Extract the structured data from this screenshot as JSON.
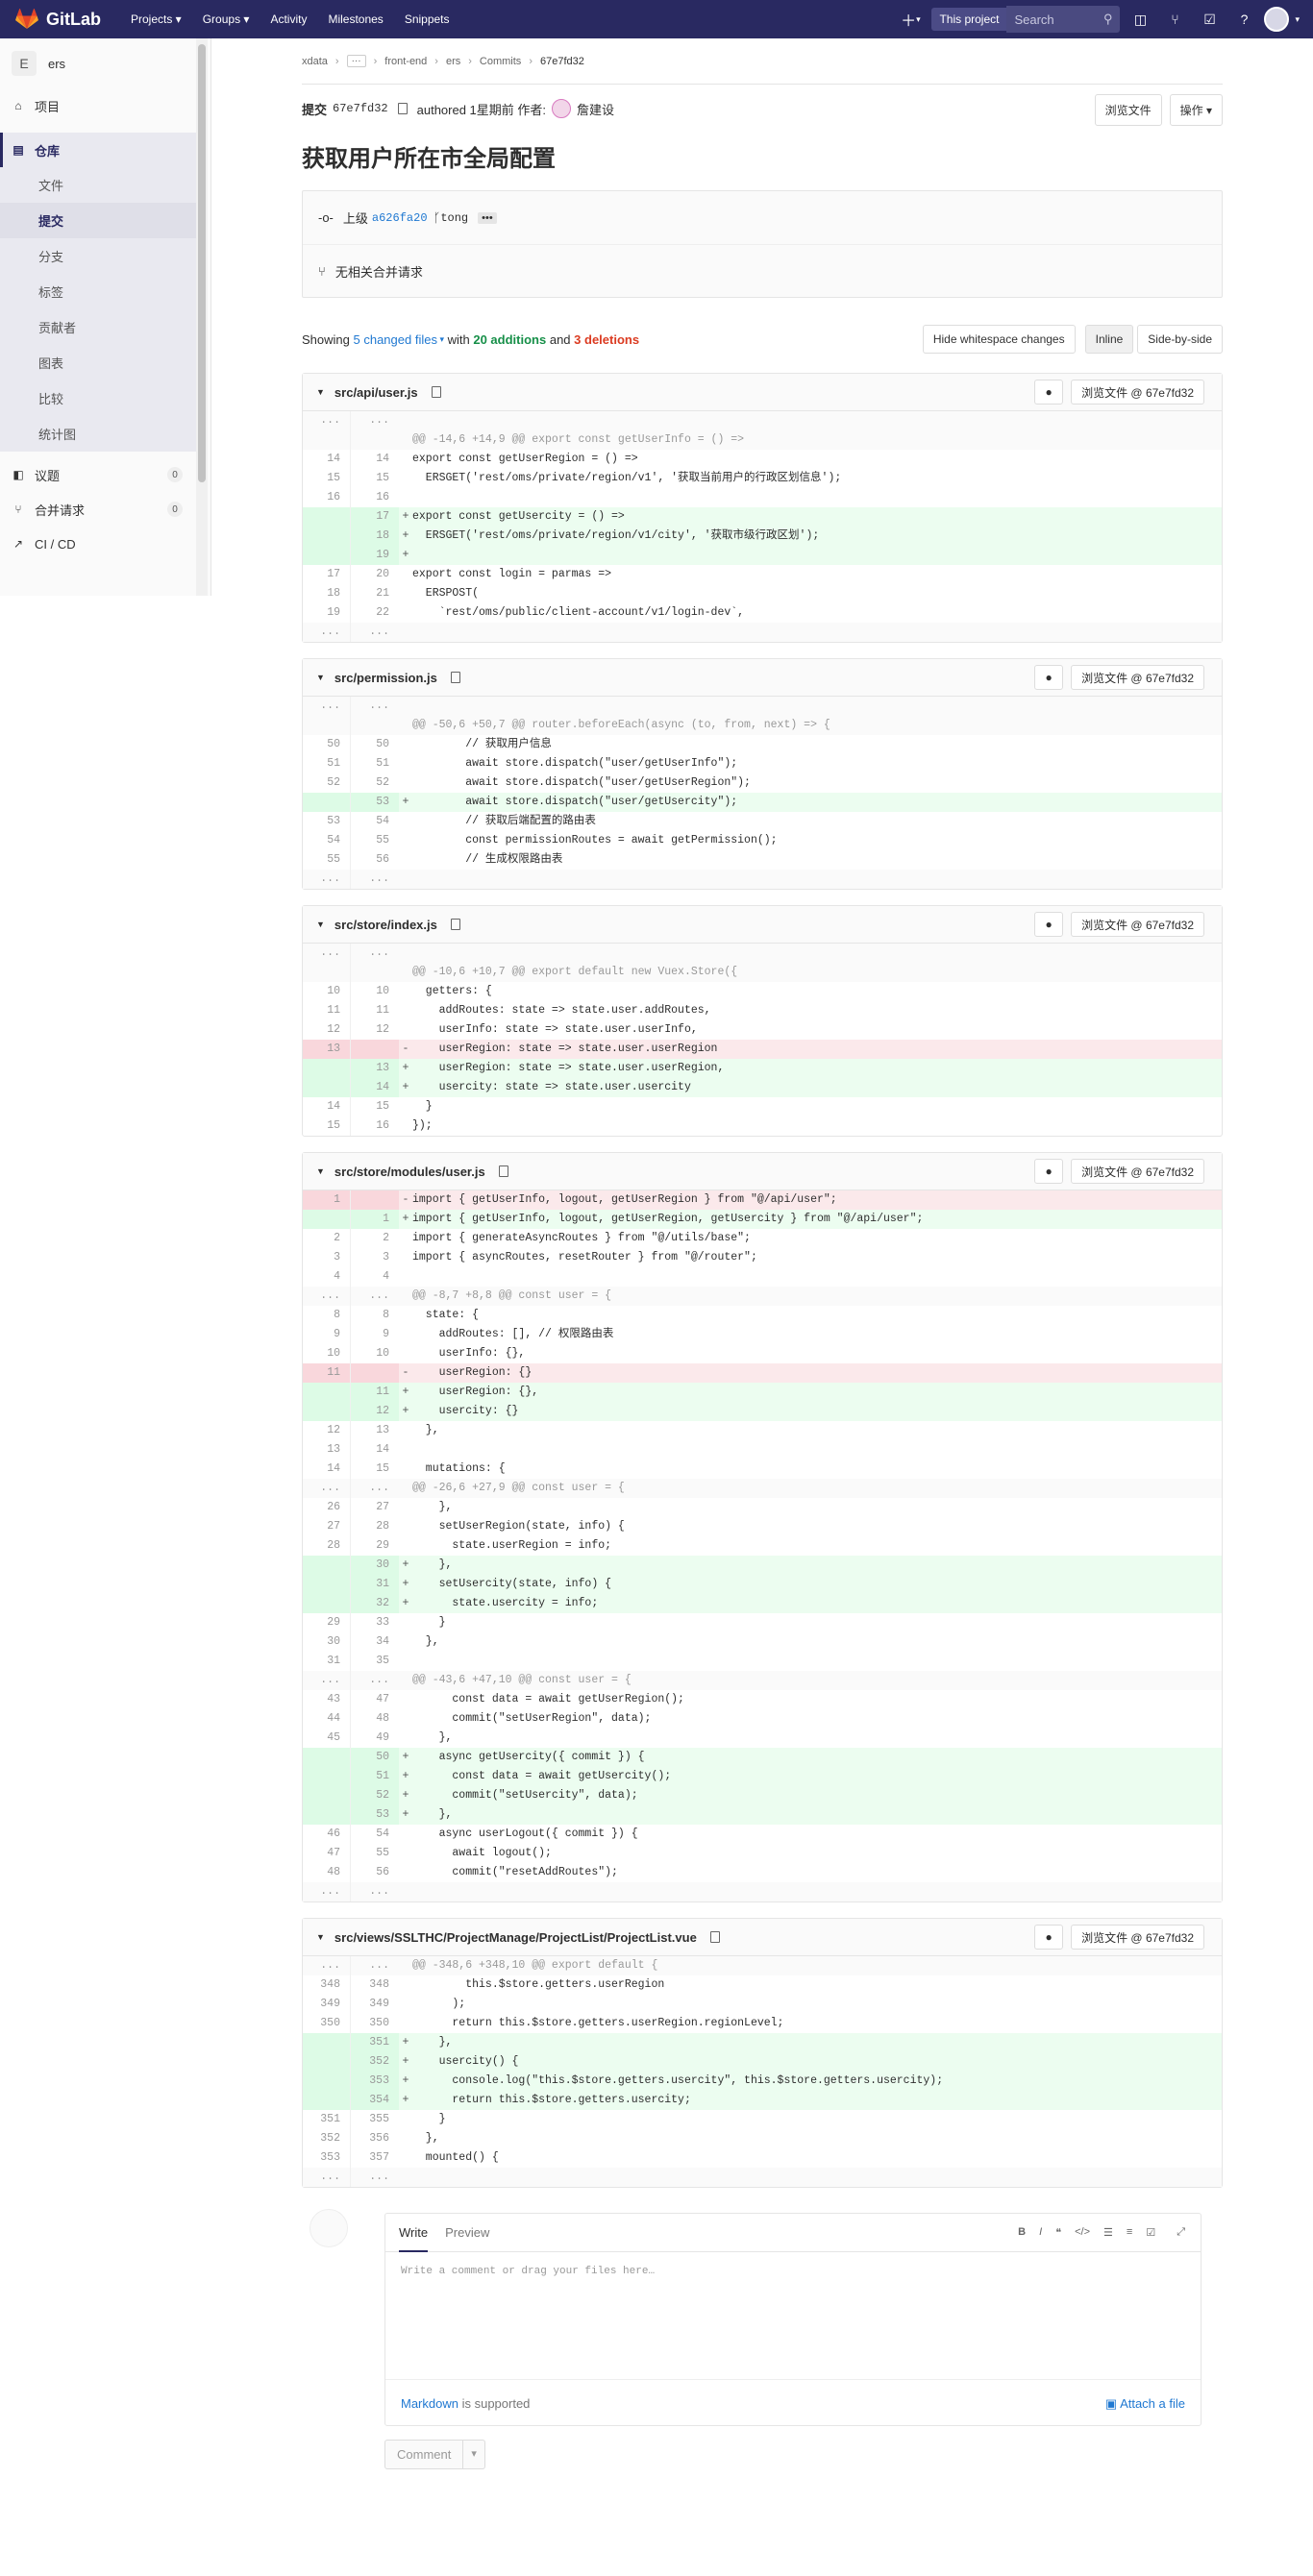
{
  "nav": {
    "brand": "GitLab",
    "links": [
      "Projects ▾",
      "Groups ▾",
      "Activity",
      "Milestones",
      "Snippets"
    ],
    "scope": "This project",
    "search_placeholder": "Search"
  },
  "sidebar": {
    "project_initial": "E",
    "project_name": "ers",
    "items": [
      {
        "label": "项目"
      },
      {
        "label": "仓库"
      },
      {
        "label": "议题",
        "count": "0"
      },
      {
        "label": "合并请求",
        "count": "0"
      },
      {
        "label": "CI / CD"
      }
    ],
    "repo_sub": [
      "文件",
      "提交",
      "分支",
      "标签",
      "贡献者",
      "图表",
      "比较",
      "统计图"
    ]
  },
  "breadcrumb": [
    "xdata",
    "front-end",
    "ers",
    "Commits",
    "67e7fd32"
  ],
  "commit": {
    "label": "提交",
    "sha": "67e7fd32",
    "authored": "authored 1星期前 作者:",
    "author": "詹建设",
    "browse": "浏览文件",
    "ops": "操作 ▾",
    "title": "获取用户所在市全局配置",
    "parent_label": "上级",
    "parent_sha": "a626fa20",
    "branch": "tong",
    "no_mr": "无相关合并请求"
  },
  "stats": {
    "showing": "Showing",
    "files": "5 changed files",
    "with": "with",
    "additions": "20 additions",
    "and": "and",
    "deletions": "3 deletions",
    "hide_ws": "Hide whitespace changes",
    "inline": "Inline",
    "side": "Side-by-side"
  },
  "view_label": "浏览文件 @ 67e7fd32",
  "files": [
    {
      "path": "src/api/user.js",
      "lines": [
        {
          "t": "gap",
          "o": "...",
          "n": "...",
          "c": ""
        },
        {
          "t": "match",
          "o": "",
          "n": "",
          "c": "@@ -14,6 +14,9 @@ export const getUserInfo = () =>"
        },
        {
          "t": "ctx",
          "o": "14",
          "n": "14",
          "c": "export const getUserRegion = () =>"
        },
        {
          "t": "ctx",
          "o": "15",
          "n": "15",
          "c": "  ERSGET('rest/oms/private/region/v1', '获取当前用户的行政区划信息');"
        },
        {
          "t": "ctx",
          "o": "16",
          "n": "16",
          "c": ""
        },
        {
          "t": "add",
          "o": "",
          "n": "17",
          "c": "export const getUsercity = () =>"
        },
        {
          "t": "add",
          "o": "",
          "n": "18",
          "c": "  ERSGET('rest/oms/private/region/v1/city', '获取市级行政区划');"
        },
        {
          "t": "add",
          "o": "",
          "n": "19",
          "c": ""
        },
        {
          "t": "ctx",
          "o": "17",
          "n": "20",
          "c": "export const login = parmas =>"
        },
        {
          "t": "ctx",
          "o": "18",
          "n": "21",
          "c": "  ERSPOST("
        },
        {
          "t": "ctx",
          "o": "19",
          "n": "22",
          "c": "    `rest/oms/public/client-account/v1/login-dev`,"
        },
        {
          "t": "gap",
          "o": "...",
          "n": "...",
          "c": ""
        }
      ]
    },
    {
      "path": "src/permission.js",
      "lines": [
        {
          "t": "gap",
          "o": "...",
          "n": "...",
          "c": ""
        },
        {
          "t": "match",
          "o": "",
          "n": "",
          "c": "@@ -50,6 +50,7 @@ router.beforeEach(async (to, from, next) => {"
        },
        {
          "t": "ctx",
          "o": "50",
          "n": "50",
          "c": "        // 获取用户信息"
        },
        {
          "t": "ctx",
          "o": "51",
          "n": "51",
          "c": "        await store.dispatch(\"user/getUserInfo\");"
        },
        {
          "t": "ctx",
          "o": "52",
          "n": "52",
          "c": "        await store.dispatch(\"user/getUserRegion\");"
        },
        {
          "t": "add",
          "o": "",
          "n": "53",
          "c": "        await store.dispatch(\"user/getUsercity\");"
        },
        {
          "t": "ctx",
          "o": "53",
          "n": "54",
          "c": "        // 获取后端配置的路由表"
        },
        {
          "t": "ctx",
          "o": "54",
          "n": "55",
          "c": "        const permissionRoutes = await getPermission();"
        },
        {
          "t": "ctx",
          "o": "55",
          "n": "56",
          "c": "        // 生成权限路由表"
        },
        {
          "t": "gap",
          "o": "...",
          "n": "...",
          "c": ""
        }
      ]
    },
    {
      "path": "src/store/index.js",
      "lines": [
        {
          "t": "gap",
          "o": "...",
          "n": "...",
          "c": ""
        },
        {
          "t": "match",
          "o": "",
          "n": "",
          "c": "@@ -10,6 +10,7 @@ export default new Vuex.Store({"
        },
        {
          "t": "ctx",
          "o": "10",
          "n": "10",
          "c": "  getters: {"
        },
        {
          "t": "ctx",
          "o": "11",
          "n": "11",
          "c": "    addRoutes: state => state.user.addRoutes,"
        },
        {
          "t": "ctx",
          "o": "12",
          "n": "12",
          "c": "    userInfo: state => state.user.userInfo,"
        },
        {
          "t": "del",
          "o": "13",
          "n": "",
          "c": "    userRegion: state => state.user.userRegion"
        },
        {
          "t": "add",
          "o": "",
          "n": "13",
          "c": "    userRegion: state => state.user.userRegion,"
        },
        {
          "t": "add",
          "o": "",
          "n": "14",
          "c": "    usercity: state => state.user.usercity"
        },
        {
          "t": "ctx",
          "o": "14",
          "n": "15",
          "c": "  }"
        },
        {
          "t": "ctx",
          "o": "15",
          "n": "16",
          "c": "});"
        }
      ]
    },
    {
      "path": "src/store/modules/user.js",
      "lines": [
        {
          "t": "del",
          "o": "1",
          "n": "",
          "c": "import { getUserInfo, logout, getUserRegion } from \"@/api/user\";"
        },
        {
          "t": "add",
          "o": "",
          "n": "1",
          "c": "import { getUserInfo, logout, getUserRegion, getUsercity } from \"@/api/user\";"
        },
        {
          "t": "ctx",
          "o": "2",
          "n": "2",
          "c": "import { generateAsyncRoutes } from \"@/utils/base\";"
        },
        {
          "t": "ctx",
          "o": "3",
          "n": "3",
          "c": "import { asyncRoutes, resetRouter } from \"@/router\";"
        },
        {
          "t": "ctx",
          "o": "4",
          "n": "4",
          "c": ""
        },
        {
          "t": "match",
          "o": "...",
          "n": "...",
          "c": "@@ -8,7 +8,8 @@ const user = {"
        },
        {
          "t": "ctx",
          "o": "8",
          "n": "8",
          "c": "  state: {"
        },
        {
          "t": "ctx",
          "o": "9",
          "n": "9",
          "c": "    addRoutes: [], // 权限路由表"
        },
        {
          "t": "ctx",
          "o": "10",
          "n": "10",
          "c": "    userInfo: {},"
        },
        {
          "t": "del",
          "o": "11",
          "n": "",
          "c": "    userRegion: {}"
        },
        {
          "t": "add",
          "o": "",
          "n": "11",
          "c": "    userRegion: {},"
        },
        {
          "t": "add",
          "o": "",
          "n": "12",
          "c": "    usercity: {}"
        },
        {
          "t": "ctx",
          "o": "12",
          "n": "13",
          "c": "  },"
        },
        {
          "t": "ctx",
          "o": "13",
          "n": "14",
          "c": ""
        },
        {
          "t": "ctx",
          "o": "14",
          "n": "15",
          "c": "  mutations: {"
        },
        {
          "t": "match",
          "o": "...",
          "n": "...",
          "c": "@@ -26,6 +27,9 @@ const user = {"
        },
        {
          "t": "ctx",
          "o": "26",
          "n": "27",
          "c": "    },"
        },
        {
          "t": "ctx",
          "o": "27",
          "n": "28",
          "c": "    setUserRegion(state, info) {"
        },
        {
          "t": "ctx",
          "o": "28",
          "n": "29",
          "c": "      state.userRegion = info;"
        },
        {
          "t": "add",
          "o": "",
          "n": "30",
          "c": "    },"
        },
        {
          "t": "add",
          "o": "",
          "n": "31",
          "c": "    setUsercity(state, info) {"
        },
        {
          "t": "add",
          "o": "",
          "n": "32",
          "c": "      state.usercity = info;"
        },
        {
          "t": "ctx",
          "o": "29",
          "n": "33",
          "c": "    }"
        },
        {
          "t": "ctx",
          "o": "30",
          "n": "34",
          "c": "  },"
        },
        {
          "t": "ctx",
          "o": "31",
          "n": "35",
          "c": ""
        },
        {
          "t": "match",
          "o": "...",
          "n": "...",
          "c": "@@ -43,6 +47,10 @@ const user = {"
        },
        {
          "t": "ctx",
          "o": "43",
          "n": "47",
          "c": "      const data = await getUserRegion();"
        },
        {
          "t": "ctx",
          "o": "44",
          "n": "48",
          "c": "      commit(\"setUserRegion\", data);"
        },
        {
          "t": "ctx",
          "o": "45",
          "n": "49",
          "c": "    },"
        },
        {
          "t": "add",
          "o": "",
          "n": "50",
          "c": "    async getUsercity({ commit }) {"
        },
        {
          "t": "add",
          "o": "",
          "n": "51",
          "c": "      const data = await getUsercity();"
        },
        {
          "t": "add",
          "o": "",
          "n": "52",
          "c": "      commit(\"setUsercity\", data);"
        },
        {
          "t": "add",
          "o": "",
          "n": "53",
          "c": "    },"
        },
        {
          "t": "ctx",
          "o": "46",
          "n": "54",
          "c": "    async userLogout({ commit }) {"
        },
        {
          "t": "ctx",
          "o": "47",
          "n": "55",
          "c": "      await logout();"
        },
        {
          "t": "ctx",
          "o": "48",
          "n": "56",
          "c": "      commit(\"resetAddRoutes\");"
        },
        {
          "t": "gap",
          "o": "...",
          "n": "...",
          "c": ""
        }
      ]
    },
    {
      "path": "src/views/SSLTHC/ProjectManage/ProjectList/ProjectList.vue",
      "lines": [
        {
          "t": "match",
          "o": "...",
          "n": "...",
          "c": "@@ -348,6 +348,10 @@ export default {"
        },
        {
          "t": "ctx",
          "o": "348",
          "n": "348",
          "c": "        this.$store.getters.userRegion"
        },
        {
          "t": "ctx",
          "o": "349",
          "n": "349",
          "c": "      );"
        },
        {
          "t": "ctx",
          "o": "350",
          "n": "350",
          "c": "      return this.$store.getters.userRegion.regionLevel;"
        },
        {
          "t": "add",
          "o": "",
          "n": "351",
          "c": "    },"
        },
        {
          "t": "add",
          "o": "",
          "n": "352",
          "c": "    usercity() {"
        },
        {
          "t": "add",
          "o": "",
          "n": "353",
          "c": "      console.log(\"this.$store.getters.usercity\", this.$store.getters.usercity);"
        },
        {
          "t": "add",
          "o": "",
          "n": "354",
          "c": "      return this.$store.getters.usercity;"
        },
        {
          "t": "ctx",
          "o": "351",
          "n": "355",
          "c": "    }"
        },
        {
          "t": "ctx",
          "o": "352",
          "n": "356",
          "c": "  },"
        },
        {
          "t": "ctx",
          "o": "353",
          "n": "357",
          "c": "  mounted() {"
        },
        {
          "t": "gap",
          "o": "...",
          "n": "...",
          "c": ""
        }
      ]
    }
  ],
  "comment": {
    "write": "Write",
    "preview": "Preview",
    "placeholder": "Write a comment or drag your files here…",
    "markdown": "Markdown",
    "supported": "is supported",
    "attach": "Attach a file",
    "submit": "Comment"
  }
}
